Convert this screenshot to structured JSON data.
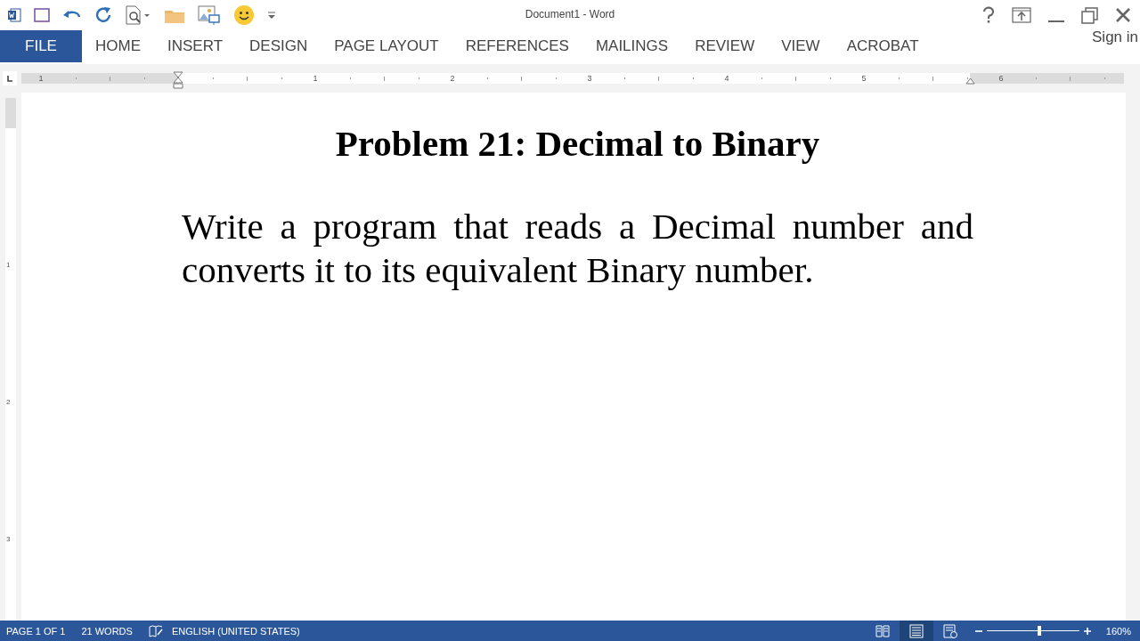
{
  "window": {
    "title": "Document1 - Word"
  },
  "account": {
    "label": "Sign in"
  },
  "tabs": [
    {
      "label": "FILE",
      "kind": "file"
    },
    {
      "label": "HOME",
      "kind": "tab"
    },
    {
      "label": "INSERT",
      "kind": "tab"
    },
    {
      "label": "DESIGN",
      "kind": "tab"
    },
    {
      "label": "PAGE LAYOUT",
      "kind": "tab"
    },
    {
      "label": "REFERENCES",
      "kind": "tab"
    },
    {
      "label": "MAILINGS",
      "kind": "tab"
    },
    {
      "label": "REVIEW",
      "kind": "tab"
    },
    {
      "label": "VIEW",
      "kind": "tab"
    },
    {
      "label": "ACROBAT",
      "kind": "tab"
    }
  ],
  "ruler": {
    "labels": [
      "1",
      "1",
      "2",
      "3",
      "4",
      "5",
      "6"
    ]
  },
  "vertical_ruler": {
    "labels": [
      "1",
      "2",
      "3"
    ]
  },
  "document": {
    "title": "Problem 21: Decimal to Binary",
    "paragraph": "Write a program that reads a Decimal number and converts it to its equivalent Binary number."
  },
  "status_bar": {
    "page": "PAGE 1 OF 1",
    "words": "21 WORDS",
    "language": "ENGLISH (UNITED STATES)",
    "view_modes": [
      {
        "selected": false
      },
      {
        "selected": true
      },
      {
        "selected": false
      }
    ],
    "zoom": {
      "level": 0.57,
      "reading": "160%"
    }
  }
}
